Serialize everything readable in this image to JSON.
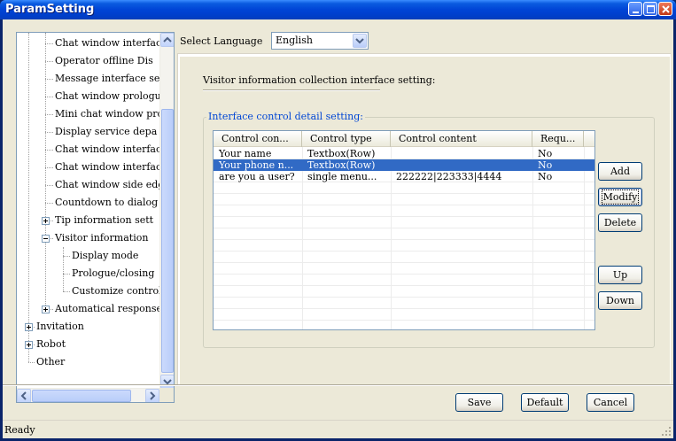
{
  "window": {
    "title": "ParamSetting"
  },
  "language": {
    "label": "Select Language",
    "selected": "English"
  },
  "tree": {
    "items": [
      {
        "label": "Chat window interfac",
        "level": 2
      },
      {
        "label": "Operator offline Dis",
        "level": 2
      },
      {
        "label": "Message interface se",
        "level": 2
      },
      {
        "label": "Chat window prologue",
        "level": 2
      },
      {
        "label": "Mini chat window pro",
        "level": 2
      },
      {
        "label": "Display service depa",
        "level": 2
      },
      {
        "label": "Chat window interfac",
        "level": 2
      },
      {
        "label": "Chat window interfac",
        "level": 2
      },
      {
        "label": "Chat window side edg",
        "level": 2
      },
      {
        "label": "Countdown to dialog",
        "level": 2
      },
      {
        "label": "Tip information sett",
        "level": 2,
        "expander": "plus"
      },
      {
        "label": "Visitor information",
        "level": 2,
        "expander": "minus"
      },
      {
        "label": "Display mode",
        "level": 3
      },
      {
        "label": "Prologue/closing",
        "level": 3
      },
      {
        "label": "Customize control",
        "level": 3
      },
      {
        "label": "Automatical response",
        "level": 2,
        "expander": "plus"
      },
      {
        "label": "Invitation",
        "level": 1,
        "expander": "plus"
      },
      {
        "label": "Robot",
        "level": 1,
        "expander": "plus"
      },
      {
        "label": "Other",
        "level": 1
      }
    ]
  },
  "section": {
    "title": "Visitor information collection interface setting:"
  },
  "group": {
    "legend": "Interface control detail setting:"
  },
  "table": {
    "columns": [
      "Control con...",
      "Control type",
      "Control content",
      "Requ..."
    ],
    "rows": [
      {
        "cells": [
          "Your name",
          "Textbox(Row)",
          "",
          "No"
        ],
        "selected": false
      },
      {
        "cells": [
          "Your phone n...",
          "Textbox(Row)",
          "",
          "No"
        ],
        "selected": true
      },
      {
        "cells": [
          "are you a user?",
          "single menu...",
          "222222|223333|4444",
          "No"
        ],
        "selected": false
      }
    ]
  },
  "side_buttons": {
    "add": "Add",
    "modify": "Modify",
    "delete": "Delete",
    "up": "Up",
    "down": "Down"
  },
  "footer": {
    "save": "Save",
    "default": "Default",
    "cancel": "Cancel"
  },
  "status": {
    "text": "Ready"
  }
}
